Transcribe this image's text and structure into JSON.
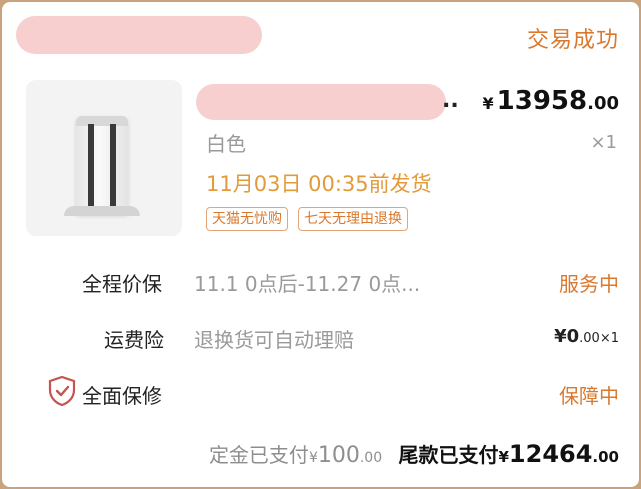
{
  "order": {
    "status": "交易成功"
  },
  "product": {
    "title_ellipsis": "..",
    "price_symbol": "¥",
    "price_int": "13958",
    "price_dec": ".00",
    "sku": "白色",
    "quantity": "×1",
    "ship_notice": "11月03日 00:35前发货",
    "tags": [
      "天猫无忧购",
      "七天无理由退换"
    ]
  },
  "services": [
    {
      "label": "全程价保",
      "value": "11.1 0点后-11.27 0点...",
      "status": "服务中"
    },
    {
      "label": "运费险",
      "value": "退换货可自动理赔",
      "price_int": "¥0",
      "price_dec": ".00",
      "qty": "×1"
    },
    {
      "label": "全面保修",
      "status": "保障中",
      "icon": "shield-check-icon"
    }
  ],
  "payment": {
    "deposit_label": "定金已支付",
    "deposit_symbol": "¥",
    "deposit_int": "100",
    "deposit_dec": ".00",
    "final_label": "尾款已支付",
    "final_symbol": "¥",
    "final_int": "12464",
    "final_dec": ".00"
  },
  "colors": {
    "accent": "#d9792f",
    "ship": "#e29a3a",
    "redaction": "#f7cfcf",
    "frame": "#c9a37d"
  }
}
